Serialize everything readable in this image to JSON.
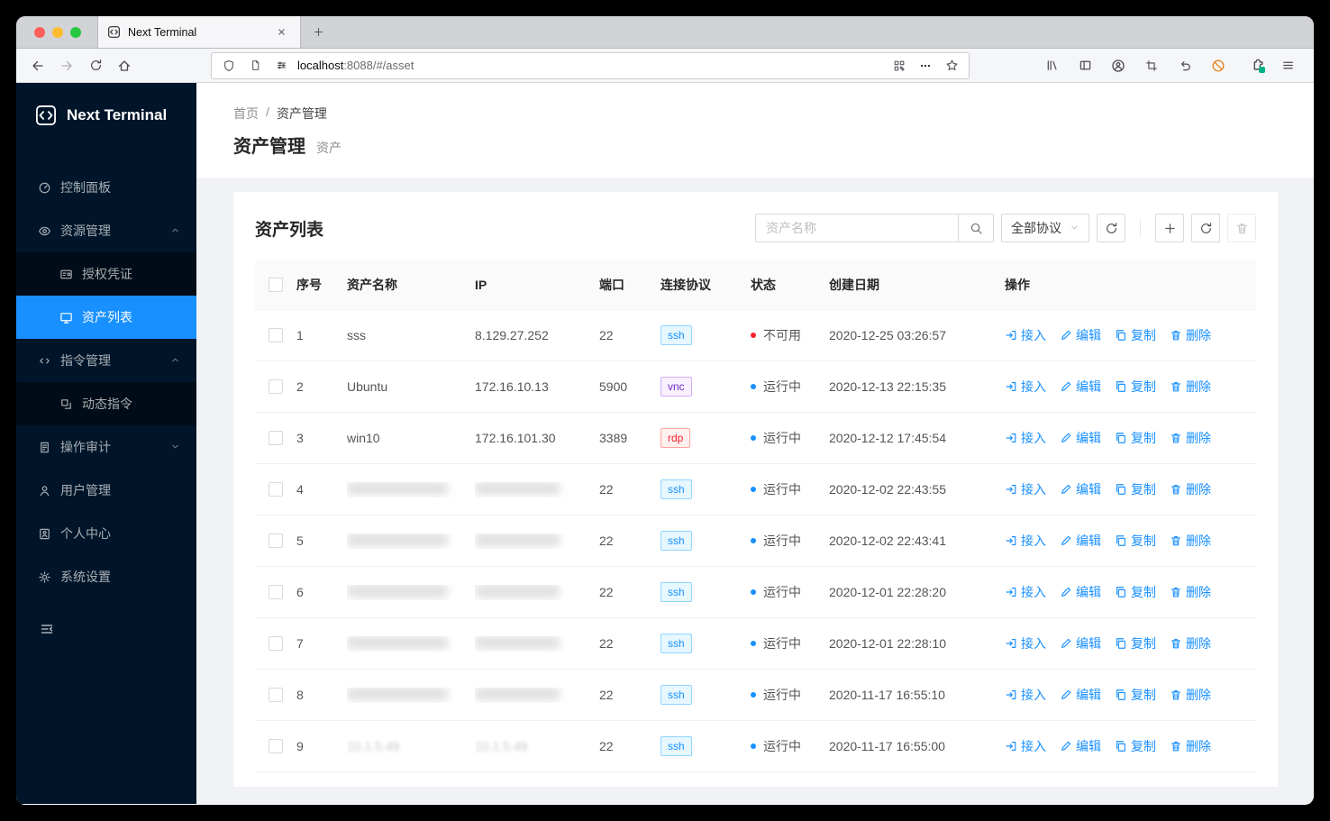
{
  "window": {
    "tab_title": "Next Terminal",
    "url": {
      "host": "localhost",
      "rest": ":8088/#/asset"
    }
  },
  "sidebar": {
    "logo": "Next Terminal",
    "items": [
      {
        "label": "控制面板"
      },
      {
        "label": "资源管理"
      },
      {
        "label": "授权凭证"
      },
      {
        "label": "资产列表"
      },
      {
        "label": "指令管理"
      },
      {
        "label": "动态指令"
      },
      {
        "label": "操作审计"
      },
      {
        "label": "用户管理"
      },
      {
        "label": "个人中心"
      },
      {
        "label": "系统设置"
      }
    ]
  },
  "page": {
    "breadcrumb": {
      "home": "首页",
      "separator": "/",
      "current": "资产管理"
    },
    "title": "资产管理",
    "subtitle": "资产"
  },
  "card": {
    "title": "资产列表",
    "search_placeholder": "资产名称",
    "protocol_filter": "全部协议"
  },
  "colors": {
    "accent": "#1890ff",
    "status_error": "#f5222d",
    "status_processing": "#1890ff",
    "sidebar_bg": "#001529"
  },
  "table": {
    "headers": [
      "序号",
      "资产名称",
      "IP",
      "端口",
      "连接协议",
      "状态",
      "创建日期",
      "操作"
    ],
    "actions": [
      "接入",
      "编辑",
      "复制",
      "删除"
    ],
    "rows": [
      {
        "no": "1",
        "name": "sss",
        "ip": "8.129.27.252",
        "port": "22",
        "protocol": "ssh",
        "status": "不可用",
        "status_type": "error",
        "created": "2020-12-25 03:26:57",
        "blurred": false
      },
      {
        "no": "2",
        "name": "Ubuntu",
        "ip": "172.16.10.13",
        "port": "5900",
        "protocol": "vnc",
        "status": "运行中",
        "status_type": "processing",
        "created": "2020-12-13 22:15:35",
        "blurred": false
      },
      {
        "no": "3",
        "name": "win10",
        "ip": "172.16.101.30",
        "port": "3389",
        "protocol": "rdp",
        "status": "运行中",
        "status_type": "processing",
        "created": "2020-12-12 17:45:54",
        "blurred": false
      },
      {
        "no": "4",
        "name": null,
        "ip": null,
        "port": "22",
        "protocol": "ssh",
        "status": "运行中",
        "status_type": "processing",
        "created": "2020-12-02 22:43:55",
        "blurred": true
      },
      {
        "no": "5",
        "name": null,
        "ip": null,
        "port": "22",
        "protocol": "ssh",
        "status": "运行中",
        "status_type": "processing",
        "created": "2020-12-02 22:43:41",
        "blurred": true
      },
      {
        "no": "6",
        "name": null,
        "ip": null,
        "port": "22",
        "protocol": "ssh",
        "status": "运行中",
        "status_type": "processing",
        "created": "2020-12-01 22:28:20",
        "blurred": true
      },
      {
        "no": "7",
        "name": null,
        "ip": null,
        "port": "22",
        "protocol": "ssh",
        "status": "运行中",
        "status_type": "processing",
        "created": "2020-12-01 22:28:10",
        "blurred": true
      },
      {
        "no": "8",
        "name": null,
        "ip": null,
        "port": "22",
        "protocol": "ssh",
        "status": "运行中",
        "status_type": "processing",
        "created": "2020-11-17 16:55:10",
        "blurred": true
      },
      {
        "no": "9",
        "name": "10.1.5.49",
        "ip": "10.1.5.49",
        "port": "22",
        "protocol": "ssh",
        "status": "运行中",
        "status_type": "processing",
        "created": "2020-11-17 16:55:00",
        "blurred": true
      }
    ]
  }
}
